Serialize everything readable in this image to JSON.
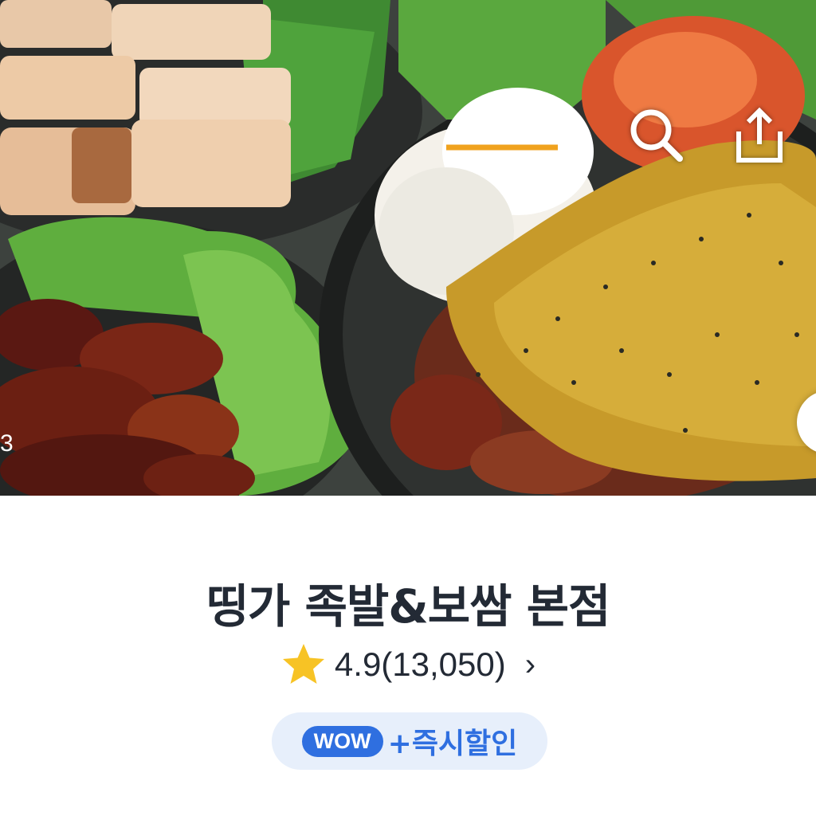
{
  "hero": {
    "photo_description": "족발 보쌈 메뉴 사진",
    "photo_counter": "3",
    "search_icon": "search-icon",
    "share_icon": "share-icon"
  },
  "store": {
    "name": "띵가 족발&보쌈 본점",
    "rating_text": "4.9(13,050)",
    "rating_chevron": "›",
    "star_icon": "star-icon",
    "star_color": "#F7C325"
  },
  "promo": {
    "badge": "WOW",
    "label": "+즉시할인",
    "accent_color": "#2F6FE0",
    "pill_color": "#E7EFFB"
  }
}
